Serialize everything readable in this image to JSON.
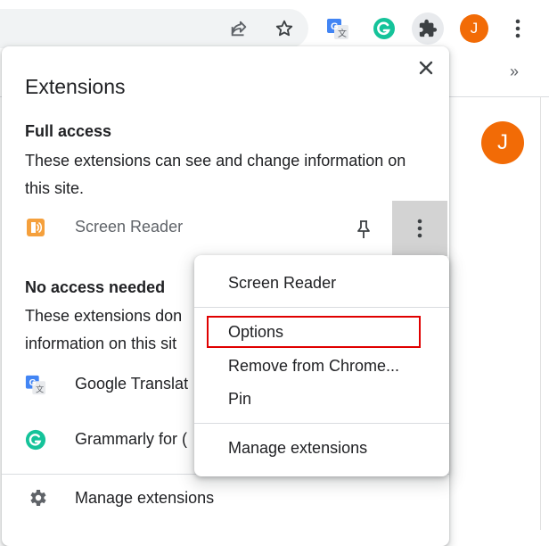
{
  "popup": {
    "title": "Extensions",
    "full_access": {
      "title": "Full access",
      "description": "These extensions can see and change information on this site.",
      "items": [
        {
          "name": "Screen Reader",
          "icon": "screen-reader-icon"
        }
      ]
    },
    "no_access": {
      "title": "No access needed",
      "description": "These extensions don information on this sit",
      "items": [
        {
          "name": "Google Translat",
          "icon": "google-translate-icon"
        },
        {
          "name": "Grammarly for (",
          "icon": "grammarly-icon"
        }
      ]
    },
    "footer": {
      "label": "Manage extensions",
      "icon": "gear-icon"
    }
  },
  "context_menu": {
    "header": "Screen Reader",
    "items": [
      "Options",
      "Remove from Chrome...",
      "Pin"
    ],
    "footer": "Manage extensions",
    "highlighted": "Options"
  },
  "profile": {
    "initial": "J",
    "color": "#f26b06"
  },
  "colors": {
    "grammarly": "#15c39a",
    "translate_blue": "#4285f4",
    "screen_reader_orange": "#f5a03c",
    "highlight_red": "#e00000"
  }
}
